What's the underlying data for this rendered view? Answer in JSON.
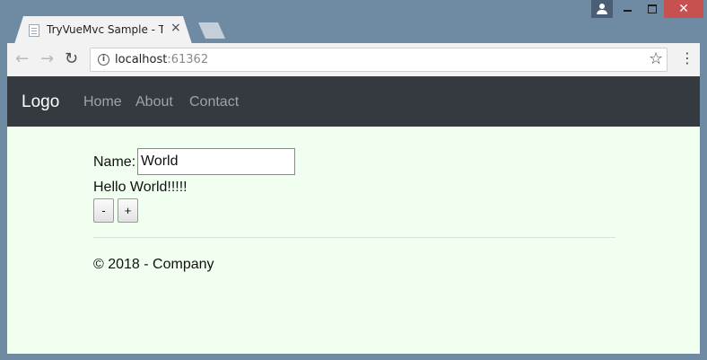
{
  "window": {
    "tab_title": "TryVueMvc Sample - TryVue",
    "close_tab_glyph": "×",
    "close_window_glyph": "✕",
    "chrome_color": "#6f8aa3",
    "close_color": "#c75050"
  },
  "toolbar": {
    "url_host": "localhost",
    "url_port": ":61362",
    "back_glyph": "←",
    "forward_glyph": "→",
    "reload_glyph": "↻",
    "star_glyph": "☆",
    "menu_glyph": "⋮",
    "info_glyph": "i"
  },
  "navbar": {
    "brand": "Logo",
    "links": [
      "Home",
      "About",
      "Contact"
    ],
    "background": "#343a40"
  },
  "main": {
    "name_label": "Name:",
    "name_value": "World",
    "greeting": "Hello World!!!!!",
    "decrement_label": "-",
    "increment_label": "+",
    "background": "#f0fff0"
  },
  "footer": {
    "text": "© 2018 - Company"
  }
}
